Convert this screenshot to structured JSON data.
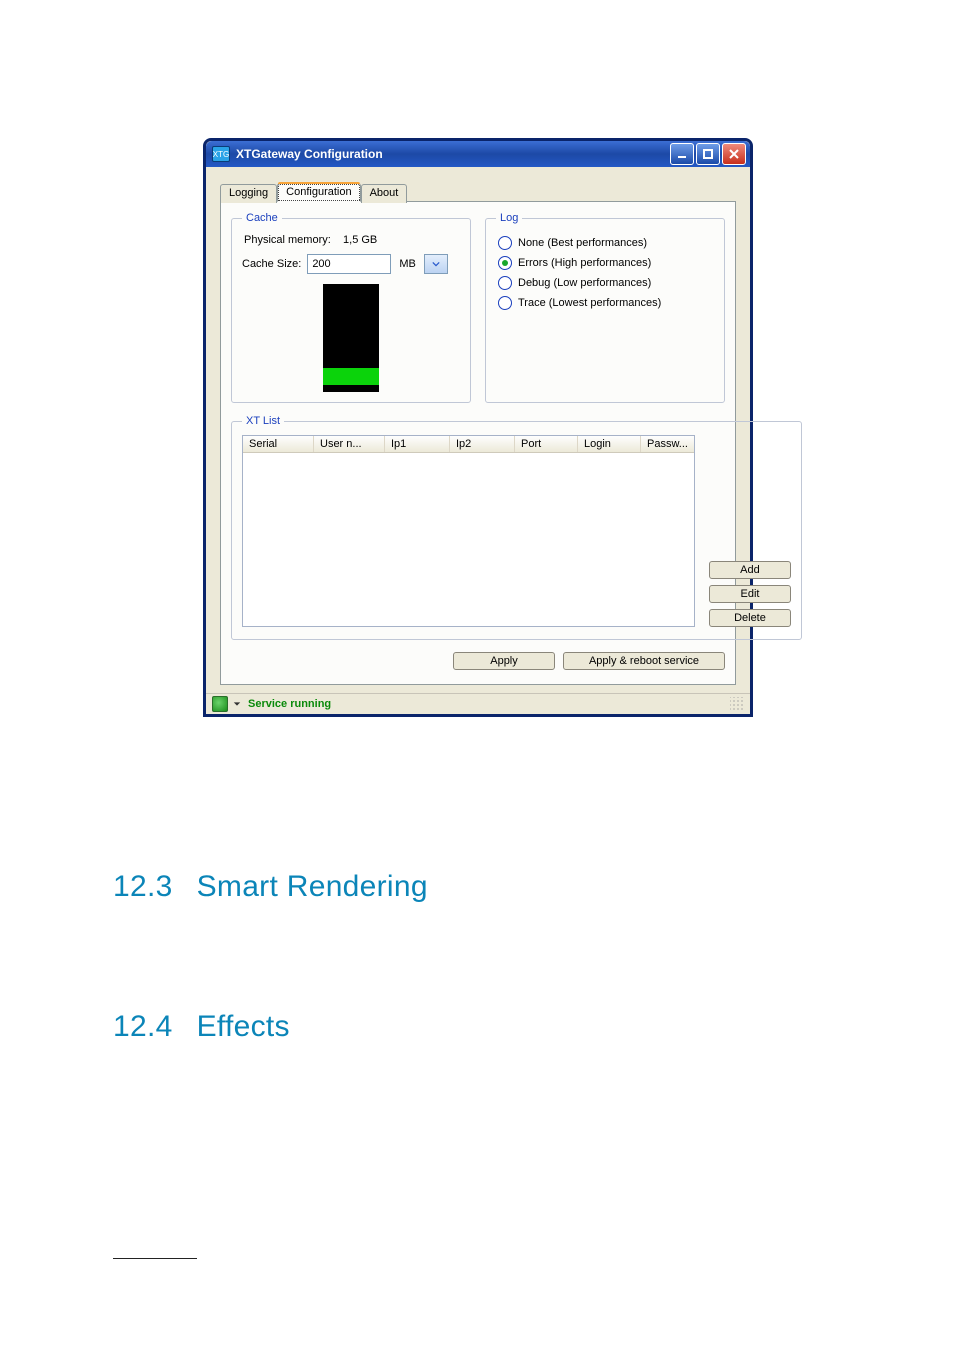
{
  "window": {
    "title": "XTGateway Configuration",
    "tabs": [
      "Logging",
      "Configuration",
      "About"
    ],
    "active_tab": 1
  },
  "cache": {
    "legend": "Cache",
    "phys_label": "Physical memory:",
    "phys_value": "1,5 GB",
    "size_label": "Cache Size:",
    "size_value": "200",
    "unit_label": "MB"
  },
  "log": {
    "legend": "Log",
    "options": [
      "None (Best performances)",
      "Errors (High performances)",
      "Debug (Low performances)",
      "Trace (Lowest performances)"
    ],
    "selected": 1
  },
  "xtlist": {
    "legend": "XT List",
    "columns": [
      "Serial",
      "User n...",
      "Ip1",
      "Ip2",
      "Port",
      "Login",
      "Passw..."
    ],
    "buttons": {
      "add": "Add",
      "edit": "Edit",
      "del": "Delete"
    }
  },
  "footer": {
    "apply": "Apply",
    "apply_reboot": "Apply & reboot service"
  },
  "status": {
    "text": "Service running"
  },
  "sections": {
    "s1_num": "12.3",
    "s1_title": "Smart Rendering",
    "s2_num": "12.4",
    "s2_title": "Effects"
  }
}
